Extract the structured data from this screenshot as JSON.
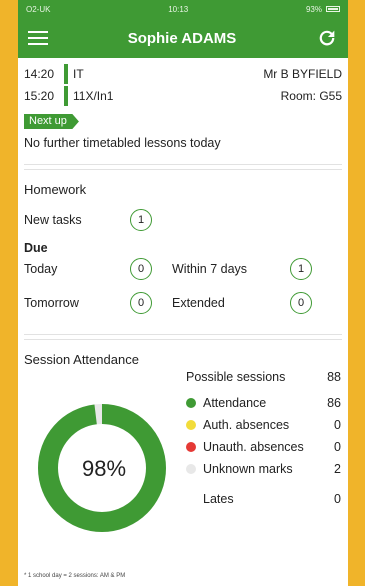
{
  "status": {
    "carrier": "O2-UK",
    "time": "10:13",
    "battery": "93%"
  },
  "appbar": {
    "title": "Sophie ADAMS"
  },
  "lessons": [
    {
      "time": "14:20",
      "subject": "IT",
      "right": "Mr B BYFIELD"
    },
    {
      "time": "15:20",
      "subject": "11X/In1",
      "right": "Room: G55"
    }
  ],
  "next_up": {
    "badge": "Next up",
    "message": "No further timetabled lessons today"
  },
  "homework": {
    "title": "Homework",
    "new_tasks_label": "New tasks",
    "new_tasks_count": "1",
    "due_label": "Due",
    "today_label": "Today",
    "today_count": "0",
    "within7_label": "Within 7 days",
    "within7_count": "1",
    "tomorrow_label": "Tomorrow",
    "tomorrow_count": "0",
    "extended_label": "Extended",
    "extended_count": "0"
  },
  "attendance": {
    "title": "Session Attendance",
    "percent_label": "98%",
    "percent_value": 98,
    "possible_label": "Possible sessions",
    "possible_value": "88",
    "attendance_label": "Attendance",
    "attendance_value": "86",
    "auth_label": "Auth. absences",
    "auth_value": "0",
    "unauth_label": "Unauth. absences",
    "unauth_value": "0",
    "unknown_label": "Unknown marks",
    "unknown_value": "2",
    "lates_label": "Lates",
    "lates_value": "0",
    "footnote": "* 1 school day = 2 sessions: AM & PM"
  },
  "colors": {
    "brand_green": "#3f9a34",
    "auth_yellow": "#f2dc3a",
    "unauth_red": "#e53935",
    "unknown_grey": "#e8e8e8"
  }
}
